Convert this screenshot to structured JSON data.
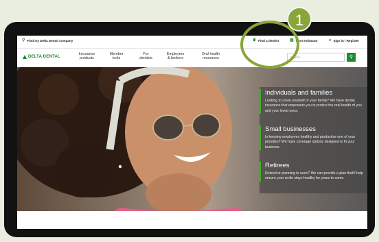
{
  "callout": {
    "number": "1"
  },
  "utility": {
    "find_company": "Find my Delta Dental company",
    "find_dentist": "Find a dentist",
    "cost_estimator": "Cost estimator",
    "sign_in": "Sign in / Register"
  },
  "brand": {
    "logo_text": "DELTA DENTAL"
  },
  "nav": {
    "items": [
      {
        "label": "Insurance\nproducts"
      },
      {
        "label": "Member\ntools"
      },
      {
        "label": "For\ndentists"
      },
      {
        "label": "Employers\n& brokers"
      },
      {
        "label": "Oral health\nresources"
      }
    ]
  },
  "search": {
    "placeholder": "Search",
    "button_icon": "search-icon"
  },
  "hero": {
    "cards": [
      {
        "title": "Individuals and families",
        "text": "Looking to cover yourself or your family? We have dental insurance that empowers you to protect the oral health of you and your loved ones."
      },
      {
        "title": "Small businesses",
        "text": "Is keeping employees healthy and productive one of your priorities? We have coverage options designed to fit your business."
      },
      {
        "title": "Retirees",
        "text": "Retired or planning to soon? We can provide a plan that'll help ensure your smile stays healthy for years to come."
      }
    ]
  },
  "colors": {
    "brand_green": "#1f8a2e",
    "accent_green": "#3fae2a",
    "callout_olive": "#8aa63a",
    "page_background": "#e9eee0"
  }
}
